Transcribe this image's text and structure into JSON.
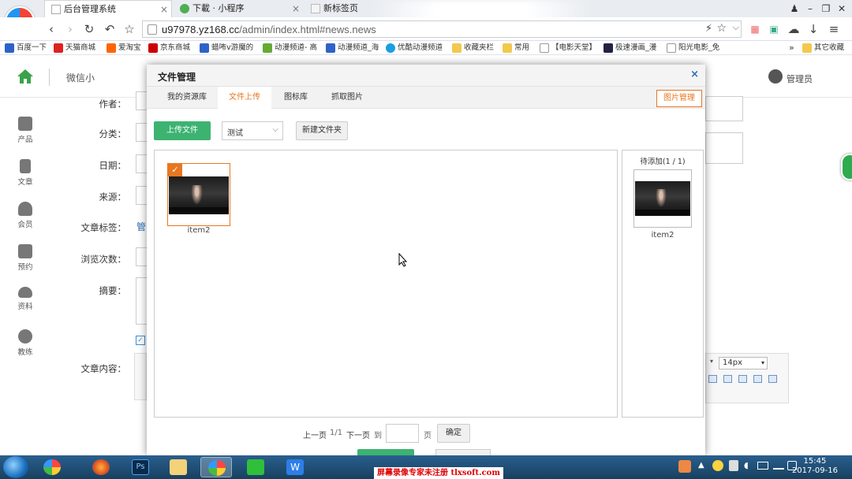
{
  "browser": {
    "tabs": [
      {
        "label": "后台管理系统",
        "close": "×"
      },
      {
        "label": "下載 · 小程序",
        "close": "×"
      },
      {
        "label": "新标签页",
        "close": "×"
      }
    ],
    "url_host": "u97978.yz168.cc",
    "url_path": "/admin/index.html#news.news",
    "bookmarks": [
      "百度一下",
      "天猫商城",
      "爱淘宝",
      "京东商城",
      "蜡咘v游魔的",
      "动漫频道- 高",
      "动漫频道_海",
      "优酷动漫频道",
      "收藏夹栏",
      "常用",
      "【电影天堂】",
      "极速漫画_漫",
      "阳光电影_免",
      "其它收藏"
    ],
    "more": "»"
  },
  "header": {
    "site_name": "微信小",
    "user_label": "管理员"
  },
  "sidebar": {
    "items": [
      {
        "label": "产品",
        "icon": "cubes-icon"
      },
      {
        "label": "文章",
        "icon": "document-icon"
      },
      {
        "label": "会员",
        "icon": "user-icon"
      },
      {
        "label": "预约",
        "icon": "book-icon"
      },
      {
        "label": "资料",
        "icon": "cloud-icon"
      },
      {
        "label": "教练",
        "icon": "coach-icon"
      }
    ]
  },
  "form": {
    "labels": {
      "author": "作者：",
      "category": "分类：",
      "date": "日期：",
      "source": "来源：",
      "tags": "文章标签：",
      "tags_value": "管",
      "views": "浏览次数：",
      "summary": "摘要：",
      "content": "文章内容："
    },
    "editor": {
      "font_size": "14px"
    }
  },
  "modal": {
    "title": "文件管理",
    "close": "×",
    "tabs": [
      "我的资源库",
      "文件上传",
      "图标库",
      "抓取图片"
    ],
    "active_tab": 1,
    "image_manager_button": "图片管理",
    "upload_button": "上传文件",
    "folder_select": "测试",
    "new_folder_button": "新建文件夹",
    "files": [
      {
        "name": "item2",
        "checked": true
      }
    ],
    "pending_title": "待添加(1 / 1)",
    "pending": [
      {
        "name": "item2"
      }
    ],
    "pagination": {
      "prev": "上一页",
      "page_info": "1/1",
      "next": "下一页",
      "goto": "到",
      "page_unit": "页",
      "confirm": "确定",
      "page_input": ""
    }
  },
  "taskbar": {
    "time": "15:45",
    "date": "2017-09-16",
    "watermark": "屏幕录像专家未注册 tlxsoft.com"
  },
  "colors": {
    "accent_green": "#3cb371",
    "accent_orange": "#e87722",
    "home_green": "#3aa34a"
  }
}
